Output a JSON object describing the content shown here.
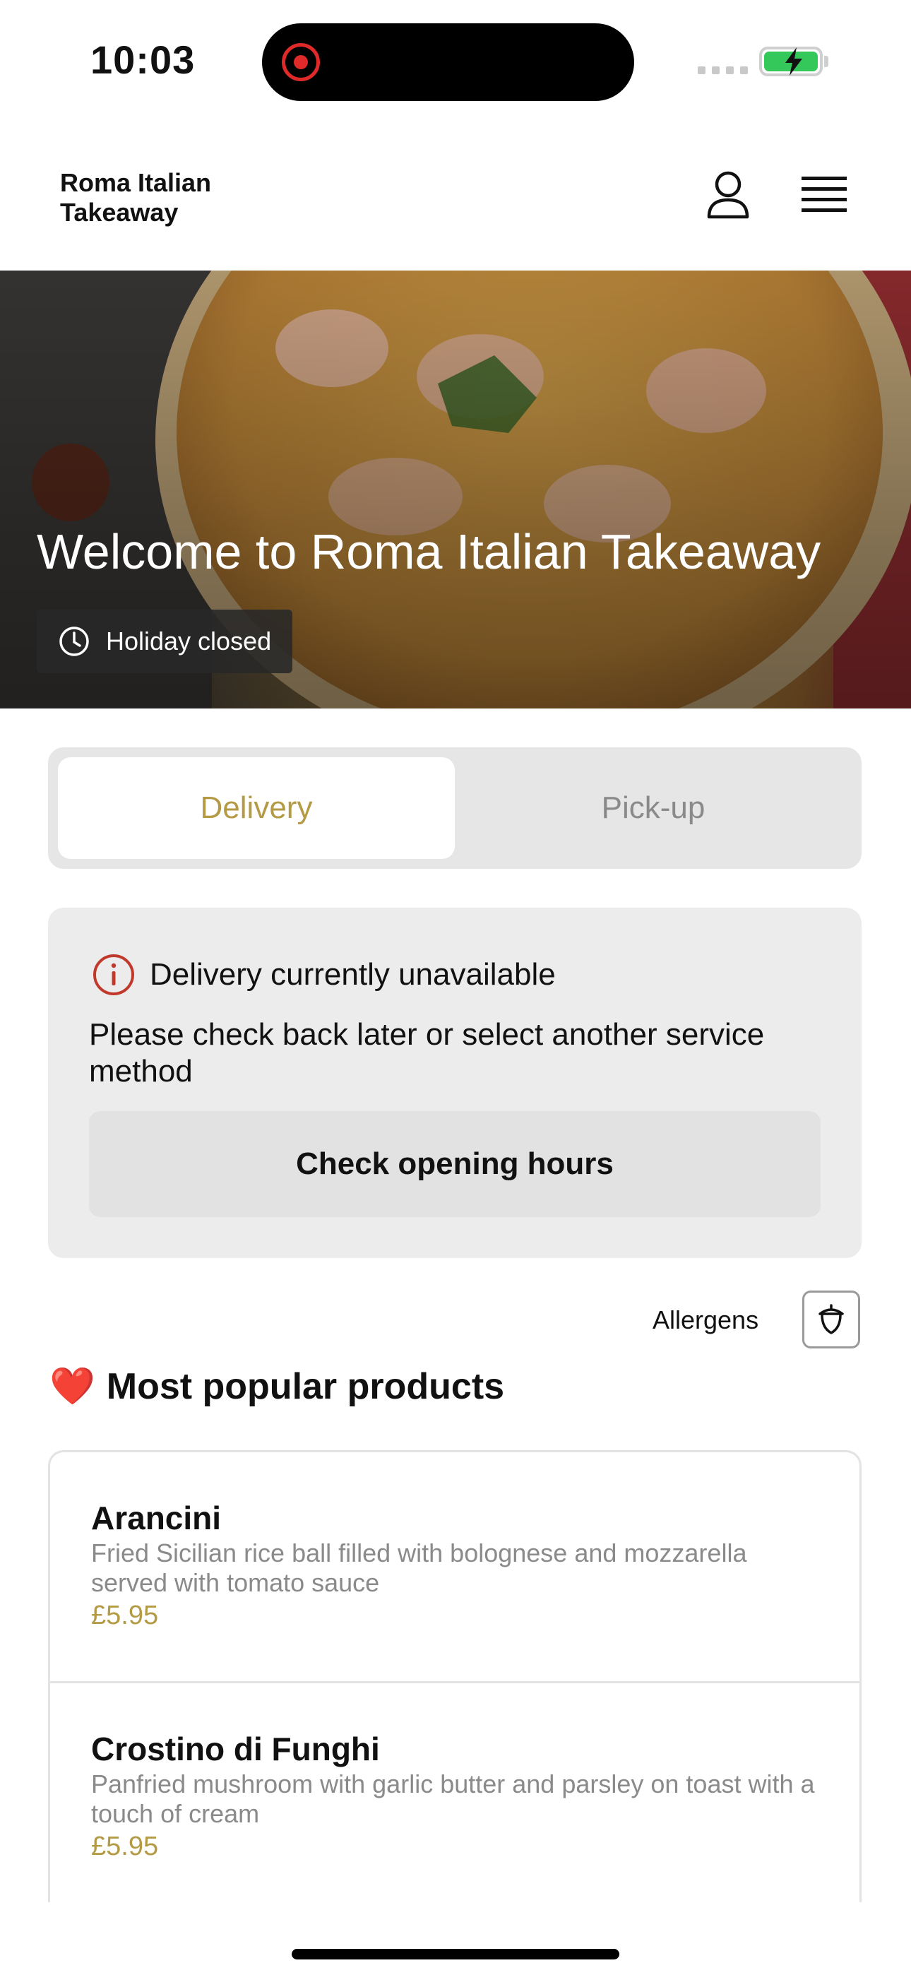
{
  "status_bar": {
    "time": "10:03"
  },
  "header": {
    "brand": "Roma Italian Takeaway"
  },
  "hero": {
    "title": "Welcome to Roma Italian Takeaway",
    "status": "Holiday closed"
  },
  "service_tabs": [
    {
      "label": "Delivery",
      "selected": true
    },
    {
      "label": "Pick-up",
      "selected": false
    }
  ],
  "notice": {
    "title": "Delivery currently unavailable",
    "message": "Please check back later or select another service method",
    "button": "Check opening hours"
  },
  "allergens": {
    "label": "Allergens"
  },
  "popular": {
    "emoji": "❤️",
    "title": "Most popular products",
    "items": [
      {
        "name": "Arancini",
        "description": "Fried Sicilian rice ball filled with bolognese and mozzarella served with tomato sauce",
        "price": "£5.95"
      },
      {
        "name": "Crostino di Funghi",
        "description": "Panfried mushroom with garlic butter and parsley on toast with a touch of cream",
        "price": "£5.95"
      }
    ]
  },
  "colors": {
    "accent": "#b49a45",
    "alert": "#c0392b",
    "battery": "#34c759"
  }
}
